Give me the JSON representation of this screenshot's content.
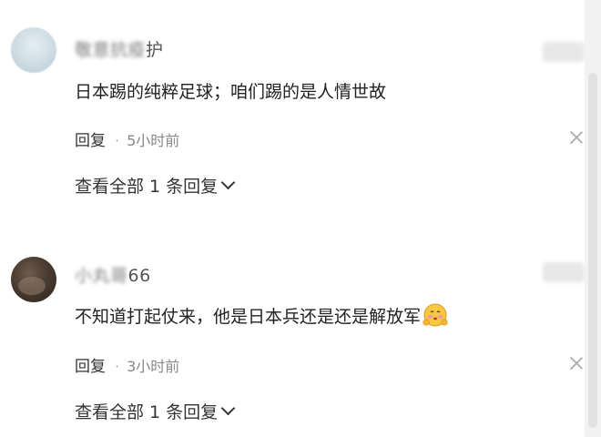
{
  "comments": [
    {
      "username_visible": "护",
      "username_obscured": "敬意抗疫",
      "text": "日本踢的纯粹足球；咱们踢的是人情世故",
      "reply_label": "回复",
      "separator": "·",
      "time": "5小时前",
      "view_replies": "查看全部 1 条回复"
    },
    {
      "username_visible": "66",
      "username_obscured": "小丸哥",
      "text": "不知道打起仗来，他是日本兵还是还是解放军",
      "emoji": "blushing-hands-emoji",
      "reply_label": "回复",
      "separator": "·",
      "time": "3小时前",
      "view_replies": "查看全部 1 条回复"
    }
  ],
  "icons": {
    "close": "close-icon",
    "chevron": "chevron-down-icon"
  },
  "colors": {
    "text": "#222222",
    "meta": "#888888",
    "background": "#ffffff"
  }
}
